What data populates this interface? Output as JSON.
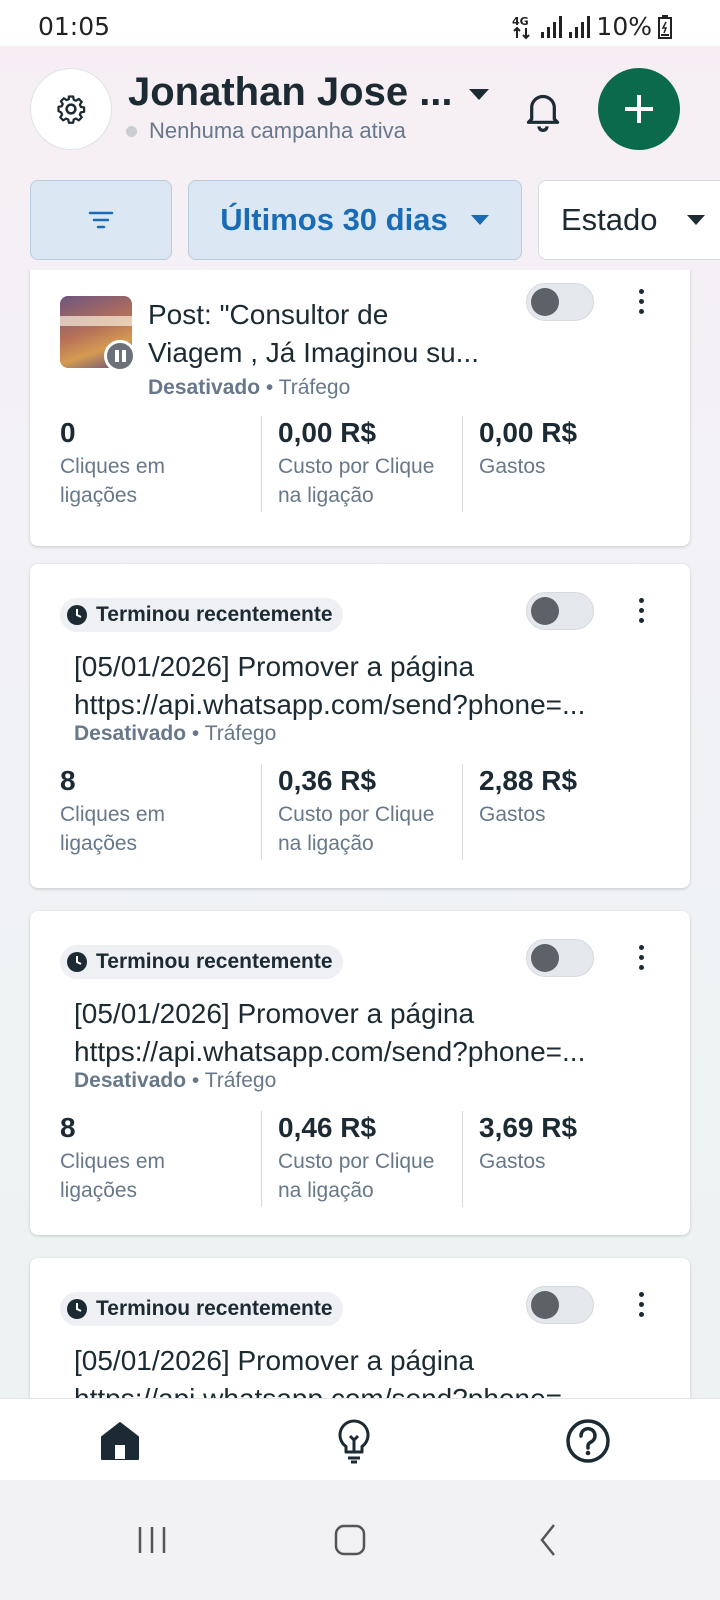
{
  "status_bar": {
    "time": "01:05",
    "network": "4G",
    "battery": "10%"
  },
  "header": {
    "account_name": "Jonathan Jose ...",
    "campaign_status": "Nenhuma campanha ativa"
  },
  "filters": {
    "date_range": "Últimos 30 dias",
    "state": "Estado"
  },
  "colors": {
    "primary_green": "#0a6a4b",
    "accent_blue": "#1a6bb5",
    "chip_bg": "#dbe8f3"
  },
  "cards": [
    {
      "badge": "",
      "title_line1": "Post: \"Consultor de",
      "title_line2": "Viagem , Já Imaginou su...",
      "status": "Desativado",
      "objective": "• Tráfego",
      "metrics": [
        {
          "value": "0",
          "label1": "Cliques em",
          "label2": "ligações"
        },
        {
          "value": "0,00 R$",
          "label1": "Custo por Clique",
          "label2": "na ligação"
        },
        {
          "value": "0,00 R$",
          "label1": "Gastos",
          "label2": ""
        }
      ]
    },
    {
      "badge": "Terminou recentemente",
      "title_line1": "[05/01/2026] Promover a página",
      "title_line2": "https://api.whatsapp.com/send?phone=...",
      "status": "Desativado",
      "objective": "• Tráfego",
      "metrics": [
        {
          "value": "8",
          "label1": "Cliques em",
          "label2": "ligações"
        },
        {
          "value": "0,36 R$",
          "label1": "Custo por Clique",
          "label2": "na ligação"
        },
        {
          "value": "2,88 R$",
          "label1": "Gastos",
          "label2": ""
        }
      ]
    },
    {
      "badge": "Terminou recentemente",
      "title_line1": "[05/01/2026] Promover a página",
      "title_line2": "https://api.whatsapp.com/send?phone=...",
      "status": "Desativado",
      "objective": "• Tráfego",
      "metrics": [
        {
          "value": "8",
          "label1": "Cliques em",
          "label2": "ligações"
        },
        {
          "value": "0,46 R$",
          "label1": "Custo por Clique",
          "label2": "na ligação"
        },
        {
          "value": "3,69 R$",
          "label1": "Gastos",
          "label2": ""
        }
      ]
    },
    {
      "badge": "Terminou recentemente",
      "title_line1": "[05/01/2026] Promover a página",
      "title_line2": "https://api.whatsapp.com/send?phone=..."
    }
  ],
  "bottom_nav": [
    "home-icon",
    "lightbulb-icon",
    "help-icon"
  ]
}
